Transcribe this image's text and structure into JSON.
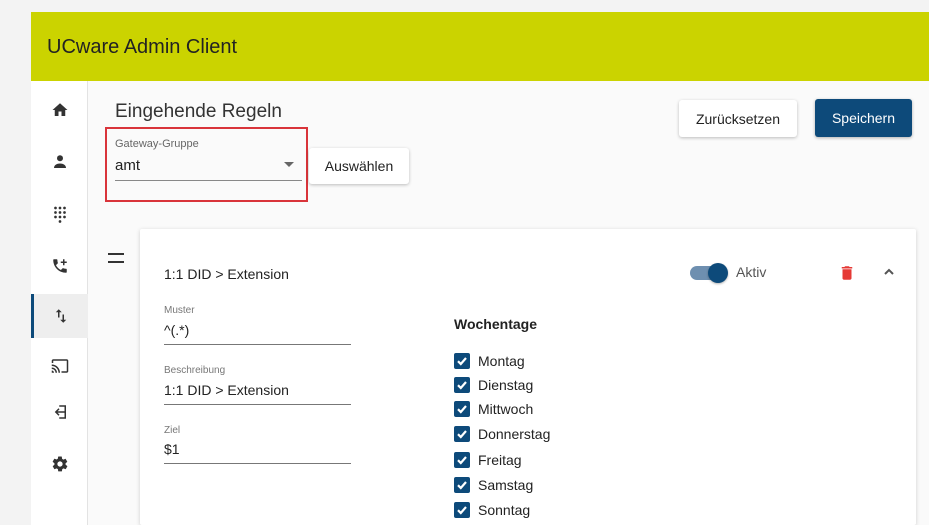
{
  "app": {
    "title": "UCware Admin Client"
  },
  "sidebar": {
    "items": [
      {
        "name": "home",
        "icon": "home-icon"
      },
      {
        "name": "user",
        "icon": "user-icon"
      },
      {
        "name": "dialpad",
        "icon": "dialpad-icon"
      },
      {
        "name": "call-forward",
        "icon": "phone-forward-icon"
      },
      {
        "name": "routing",
        "icon": "swap-vert-icon",
        "active": true
      },
      {
        "name": "cast",
        "icon": "cast-icon"
      },
      {
        "name": "login",
        "icon": "login-icon"
      },
      {
        "name": "settings",
        "icon": "gear-icon"
      }
    ]
  },
  "page": {
    "title": "Eingehende Regeln"
  },
  "gateway": {
    "label": "Gateway-Gruppe",
    "value": "amt",
    "select_label": "Auswählen"
  },
  "toolbar": {
    "reset_label": "Zurücksetzen",
    "save_label": "Speichern"
  },
  "rule": {
    "title": "1:1 DID > Extension",
    "active_label": "Aktiv",
    "active": true,
    "fields": {
      "pattern": {
        "label": "Muster",
        "value": "^(.*)"
      },
      "description": {
        "label": "Beschreibung",
        "value": "1:1 DID > Extension"
      },
      "target": {
        "label": "Ziel",
        "value": "$1"
      }
    },
    "weekdays_title": "Wochentage",
    "weekdays": [
      {
        "label": "Montag",
        "checked": true
      },
      {
        "label": "Dienstag",
        "checked": true
      },
      {
        "label": "Mittwoch",
        "checked": true
      },
      {
        "label": "Donnerstag",
        "checked": true
      },
      {
        "label": "Freitag",
        "checked": true
      },
      {
        "label": "Samstag",
        "checked": true
      },
      {
        "label": "Sonntag",
        "checked": true
      }
    ]
  },
  "colors": {
    "header": "#cbd300",
    "primary": "#0d4a7a",
    "danger": "#e53935",
    "highlight_border": "#d9343a"
  }
}
